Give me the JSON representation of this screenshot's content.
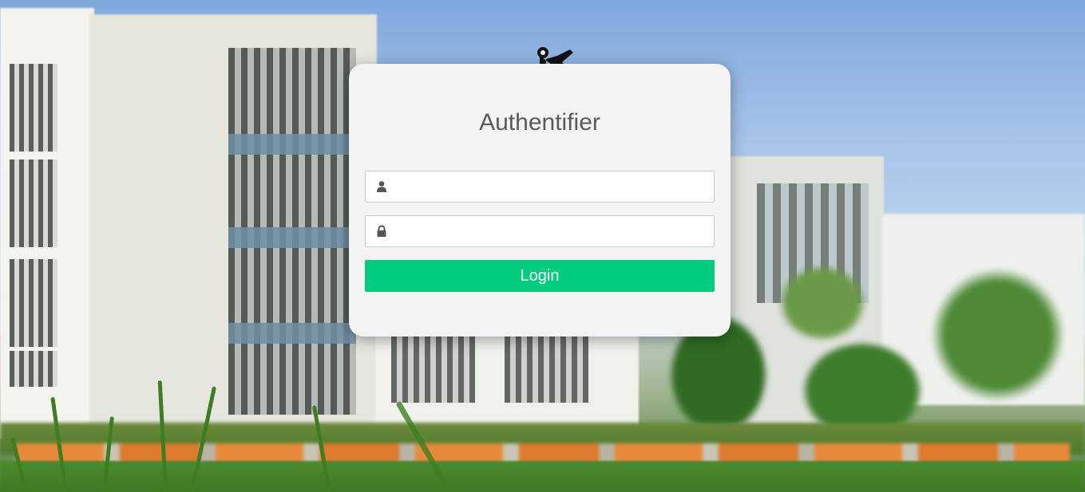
{
  "login": {
    "title": "Authentifier",
    "username": {
      "value": "",
      "placeholder": "",
      "icon": "user-icon"
    },
    "password": {
      "value": "",
      "placeholder": "",
      "icon": "lock-icon"
    },
    "submit_label": "Login"
  },
  "colors": {
    "button": "#00cc7e",
    "card": "#f3f3f3",
    "title": "#5a5a5a",
    "icon": "#555555"
  }
}
